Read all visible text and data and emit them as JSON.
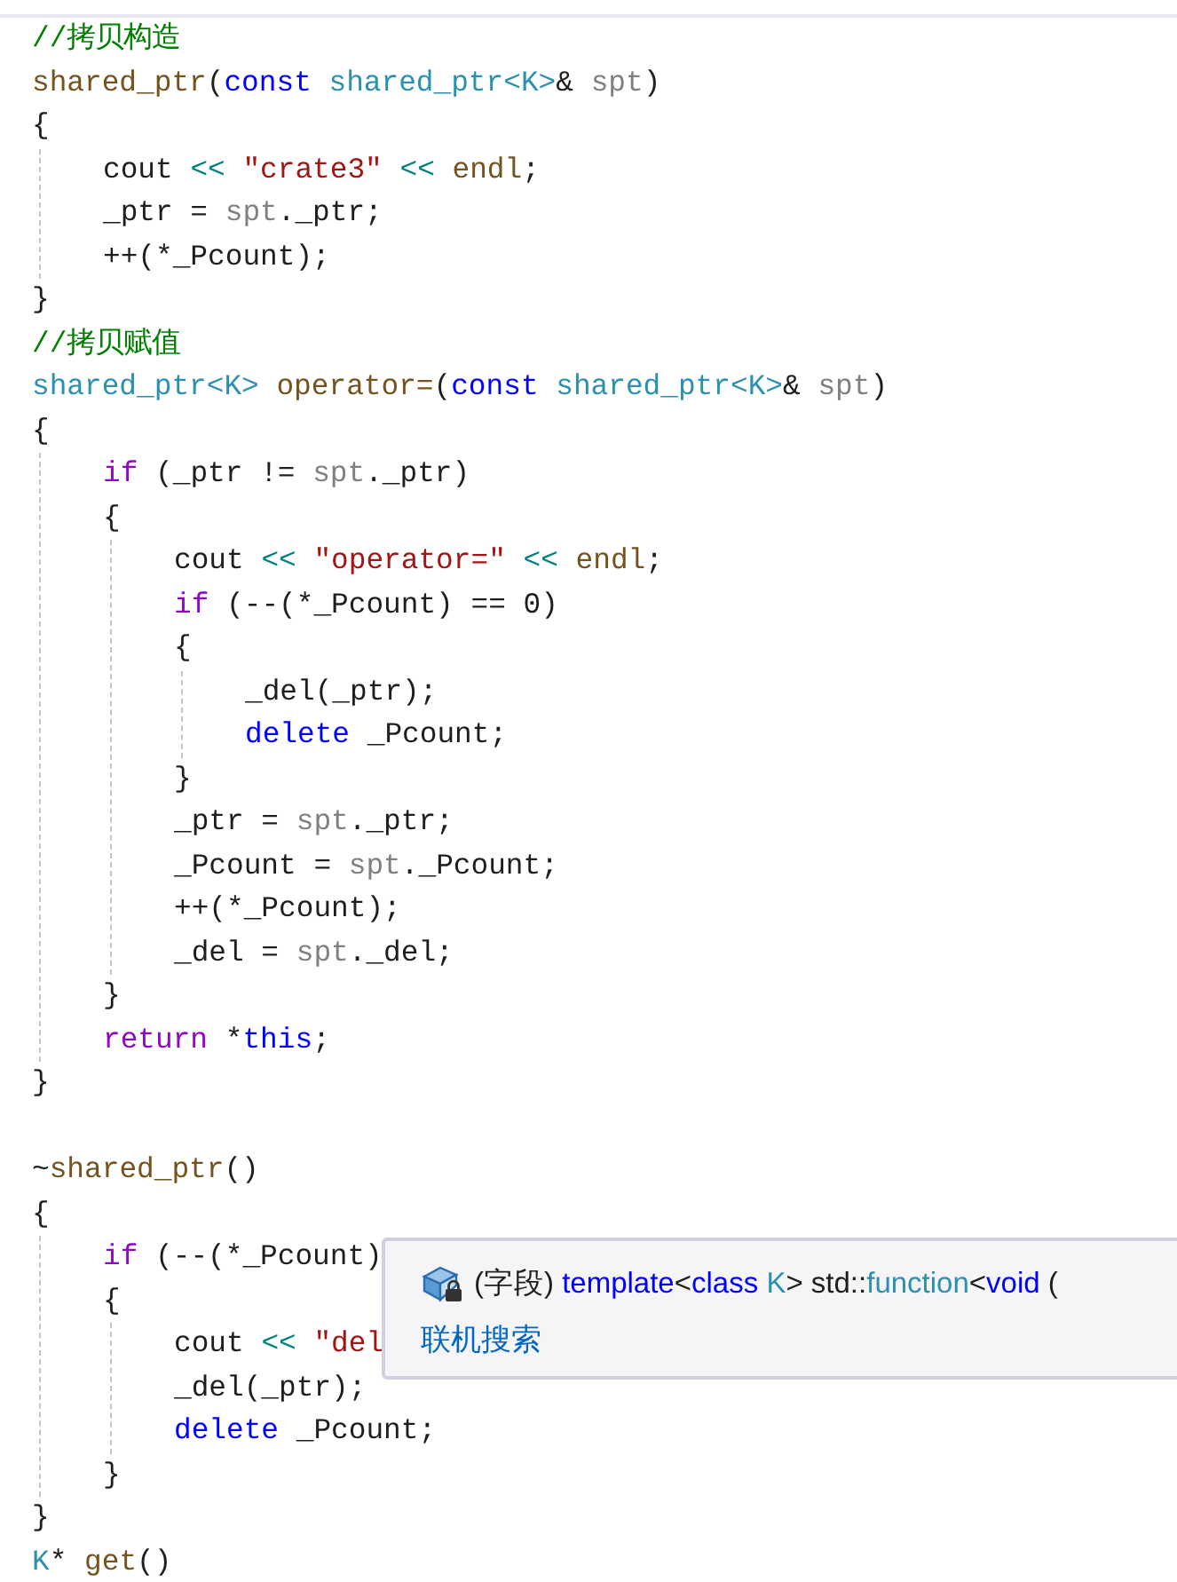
{
  "editor": {
    "lines": [
      {
        "kind": "line",
        "tokens": [
          {
            "kind": "comment",
            "text": "//拷贝构造"
          }
        ]
      },
      {
        "kind": "line",
        "tokens": [
          {
            "kind": "function",
            "text": "shared_ptr"
          },
          {
            "kind": "plain",
            "text": "("
          },
          {
            "kind": "keyword",
            "text": "const"
          },
          {
            "kind": "type",
            "text": " shared_ptr<K>"
          },
          {
            "kind": "plain",
            "text": "& "
          },
          {
            "kind": "parameter",
            "text": "spt"
          },
          {
            "kind": "plain",
            "text": ")"
          }
        ]
      },
      {
        "kind": "line",
        "tokens": [
          {
            "kind": "plain",
            "text": "{"
          }
        ]
      },
      {
        "kind": "block",
        "children": [
          {
            "kind": "line",
            "tokens": [
              {
                "kind": "plain",
                "text": "cout "
              },
              {
                "kind": "operator",
                "text": "<< "
              },
              {
                "kind": "string",
                "text": "\"crate3\" "
              },
              {
                "kind": "operator",
                "text": "<< "
              },
              {
                "kind": "function",
                "text": "endl"
              },
              {
                "kind": "plain",
                "text": ";"
              }
            ]
          },
          {
            "kind": "line",
            "tokens": [
              {
                "kind": "plain",
                "text": "_ptr = "
              },
              {
                "kind": "parameter",
                "text": "spt"
              },
              {
                "kind": "plain",
                "text": "._ptr;"
              }
            ]
          },
          {
            "kind": "line",
            "tokens": [
              {
                "kind": "plain",
                "text": "++(*_Pcount);"
              }
            ]
          }
        ]
      },
      {
        "kind": "line",
        "tokens": [
          {
            "kind": "plain",
            "text": "}"
          }
        ]
      },
      {
        "kind": "line",
        "tokens": [
          {
            "kind": "comment",
            "text": "//拷贝赋值"
          }
        ]
      },
      {
        "kind": "line",
        "tokens": [
          {
            "kind": "type",
            "text": "shared_ptr<K> "
          },
          {
            "kind": "function",
            "text": "operator="
          },
          {
            "kind": "plain",
            "text": "("
          },
          {
            "kind": "keyword",
            "text": "const"
          },
          {
            "kind": "type",
            "text": " shared_ptr<K>"
          },
          {
            "kind": "plain",
            "text": "& "
          },
          {
            "kind": "parameter",
            "text": "spt"
          },
          {
            "kind": "plain",
            "text": ")"
          }
        ]
      },
      {
        "kind": "line",
        "tokens": [
          {
            "kind": "plain",
            "text": "{"
          }
        ]
      },
      {
        "kind": "block",
        "children": [
          {
            "kind": "line",
            "tokens": [
              {
                "kind": "control",
                "text": "if"
              },
              {
                "kind": "plain",
                "text": " (_ptr != "
              },
              {
                "kind": "parameter",
                "text": "spt"
              },
              {
                "kind": "plain",
                "text": "._ptr)"
              }
            ]
          },
          {
            "kind": "line",
            "tokens": [
              {
                "kind": "plain",
                "text": "{"
              }
            ]
          },
          {
            "kind": "block",
            "children": [
              {
                "kind": "line",
                "tokens": [
                  {
                    "kind": "plain",
                    "text": "cout "
                  },
                  {
                    "kind": "operator",
                    "text": "<< "
                  },
                  {
                    "kind": "string",
                    "text": "\"operator=\" "
                  },
                  {
                    "kind": "operator",
                    "text": "<< "
                  },
                  {
                    "kind": "function",
                    "text": "endl"
                  },
                  {
                    "kind": "plain",
                    "text": ";"
                  }
                ]
              },
              {
                "kind": "line",
                "tokens": [
                  {
                    "kind": "control",
                    "text": "if"
                  },
                  {
                    "kind": "plain",
                    "text": " (--(*_Pcount) == 0)"
                  }
                ]
              },
              {
                "kind": "line",
                "tokens": [
                  {
                    "kind": "plain",
                    "text": "{"
                  }
                ]
              },
              {
                "kind": "block",
                "children": [
                  {
                    "kind": "line",
                    "tokens": [
                      {
                        "kind": "plain",
                        "text": "_del(_ptr);"
                      }
                    ]
                  },
                  {
                    "kind": "line",
                    "tokens": [
                      {
                        "kind": "keyword",
                        "text": "delete"
                      },
                      {
                        "kind": "plain",
                        "text": " _Pcount;"
                      }
                    ]
                  }
                ]
              },
              {
                "kind": "line",
                "tokens": [
                  {
                    "kind": "plain",
                    "text": "}"
                  }
                ]
              },
              {
                "kind": "line",
                "tokens": [
                  {
                    "kind": "plain",
                    "text": "_ptr = "
                  },
                  {
                    "kind": "parameter",
                    "text": "spt"
                  },
                  {
                    "kind": "plain",
                    "text": "._ptr;"
                  }
                ]
              },
              {
                "kind": "line",
                "tokens": [
                  {
                    "kind": "plain",
                    "text": "_Pcount = "
                  },
                  {
                    "kind": "parameter",
                    "text": "spt"
                  },
                  {
                    "kind": "plain",
                    "text": "._Pcount;"
                  }
                ]
              },
              {
                "kind": "line",
                "tokens": [
                  {
                    "kind": "plain",
                    "text": "++(*_Pcount);"
                  }
                ]
              },
              {
                "kind": "line",
                "tokens": [
                  {
                    "kind": "plain",
                    "text": "_del = "
                  },
                  {
                    "kind": "parameter",
                    "text": "spt"
                  },
                  {
                    "kind": "plain",
                    "text": "._del;"
                  }
                ]
              }
            ]
          },
          {
            "kind": "line",
            "tokens": [
              {
                "kind": "plain",
                "text": "}"
              }
            ]
          },
          {
            "kind": "line",
            "tokens": [
              {
                "kind": "control",
                "text": "return"
              },
              {
                "kind": "plain",
                "text": " *"
              },
              {
                "kind": "keyword",
                "text": "this"
              },
              {
                "kind": "plain",
                "text": ";"
              }
            ]
          }
        ]
      },
      {
        "kind": "line",
        "tokens": [
          {
            "kind": "plain",
            "text": "}"
          }
        ]
      },
      {
        "kind": "blank"
      },
      {
        "kind": "line",
        "tokens": [
          {
            "kind": "plain",
            "text": "~"
          },
          {
            "kind": "function",
            "text": "shared_ptr"
          },
          {
            "kind": "plain",
            "text": "()"
          }
        ]
      },
      {
        "kind": "line",
        "tokens": [
          {
            "kind": "plain",
            "text": "{"
          }
        ]
      },
      {
        "kind": "block",
        "children": [
          {
            "kind": "line",
            "tokens": [
              {
                "kind": "control",
                "text": "if"
              },
              {
                "kind": "plain",
                "text": " (--(*_Pcount)"
              }
            ]
          },
          {
            "kind": "line",
            "tokens": [
              {
                "kind": "plain",
                "text": "{"
              }
            ]
          },
          {
            "kind": "block",
            "children": [
              {
                "kind": "line",
                "tokens": [
                  {
                    "kind": "plain",
                    "text": "cout "
                  },
                  {
                    "kind": "operator",
                    "text": "<< "
                  },
                  {
                    "kind": "string",
                    "text": "\"del"
                  }
                ]
              },
              {
                "kind": "line",
                "tokens": [
                  {
                    "kind": "plain",
                    "text": "_del(_ptr);"
                  }
                ]
              },
              {
                "kind": "line",
                "tokens": [
                  {
                    "kind": "keyword",
                    "text": "delete"
                  },
                  {
                    "kind": "plain",
                    "text": " _Pcount;"
                  }
                ]
              }
            ]
          },
          {
            "kind": "line",
            "tokens": [
              {
                "kind": "plain",
                "text": "}"
              }
            ]
          }
        ]
      },
      {
        "kind": "line",
        "tokens": [
          {
            "kind": "plain",
            "text": "}"
          }
        ]
      },
      {
        "kind": "line",
        "tokens": [
          {
            "kind": "type",
            "text": "K"
          },
          {
            "kind": "plain",
            "text": "* "
          },
          {
            "kind": "function",
            "text": "get"
          },
          {
            "kind": "plain",
            "text": "()"
          }
        ]
      }
    ]
  },
  "tooltip": {
    "signature": [
      {
        "kind": "plain",
        "text": "(字段) "
      },
      {
        "kind": "keyword",
        "text": "template"
      },
      {
        "kind": "plain",
        "text": "<"
      },
      {
        "kind": "keyword",
        "text": "class"
      },
      {
        "kind": "type",
        "text": " K"
      },
      {
        "kind": "plain",
        "text": "> std::"
      },
      {
        "kind": "type",
        "text": "function"
      },
      {
        "kind": "plain",
        "text": "<"
      },
      {
        "kind": "keyword",
        "text": "void"
      },
      {
        "kind": "plain",
        "text": " ("
      }
    ],
    "link": "联机搜索"
  }
}
